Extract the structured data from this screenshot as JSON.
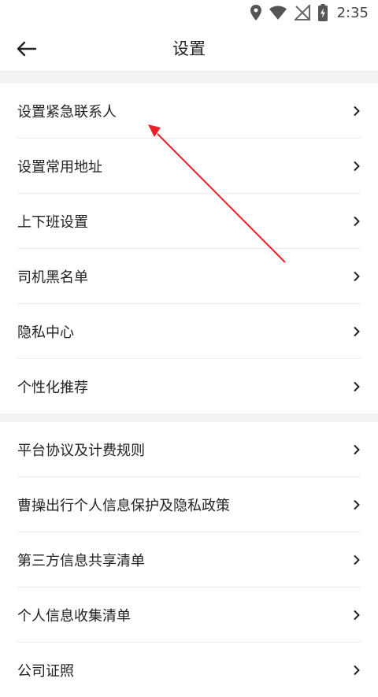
{
  "status_bar": {
    "time": "2:35",
    "icons": [
      "location-icon",
      "wifi-icon",
      "no-signal-icon",
      "battery-charging-icon"
    ]
  },
  "header": {
    "title": "设置",
    "back_icon": "arrow-left-icon"
  },
  "groups": [
    {
      "items": [
        {
          "label": "设置紧急联系人"
        },
        {
          "label": "设置常用地址"
        },
        {
          "label": "上下班设置"
        },
        {
          "label": "司机黑名单"
        },
        {
          "label": "隐私中心"
        },
        {
          "label": "个性化推荐"
        }
      ]
    },
    {
      "items": [
        {
          "label": "平台协议及计费规则"
        },
        {
          "label": "曹操出行个人信息保护及隐私政策"
        },
        {
          "label": "第三方信息共享清单"
        },
        {
          "label": "个人信息收集清单"
        },
        {
          "label": "公司证照"
        }
      ]
    }
  ],
  "annotation": {
    "color": "#e8202a"
  }
}
